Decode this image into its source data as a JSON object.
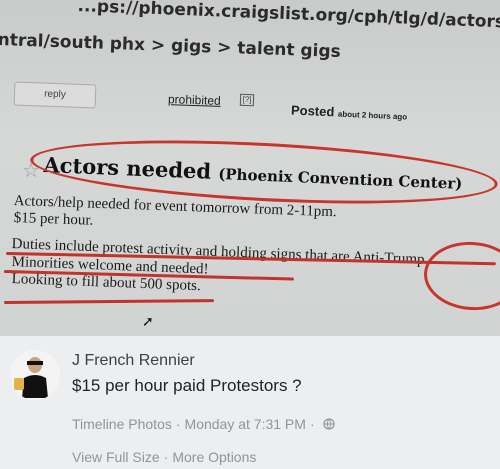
{
  "listing": {
    "url": "...ps://phoenix.craigslist.org/cph/tlg/d/actors-needed/c",
    "breadcrumb": "ntral/south phx > gigs > talent gigs",
    "reply_label": "reply",
    "prohibited_label": "prohibited",
    "prohibited_icon_text": "[?]",
    "posted_label": "Posted",
    "posted_ago": "about 2 hours ago",
    "title": "Actors needed",
    "title_sub": "(Phoenix Convention Center)",
    "lines": [
      "Actors/help needed for event tomorrow from 2-11pm.",
      "$15 per hour.",
      "Duties include protest activity and holding signs that are Anti-Trump",
      "Minorities welcome and needed!",
      "Looking to fill about 500 spots."
    ]
  },
  "post": {
    "author": "J French Rennier",
    "text": "$15 per hour paid Protestors ?",
    "source": "Timeline Photos",
    "time": "Monday at 7:31 PM",
    "privacy_icon": "globe-icon",
    "view_full_size": "View Full Size",
    "more_options": "More Options"
  },
  "colors": {
    "annotation_red": "#c7362d",
    "meta_gray": "#90949c"
  }
}
